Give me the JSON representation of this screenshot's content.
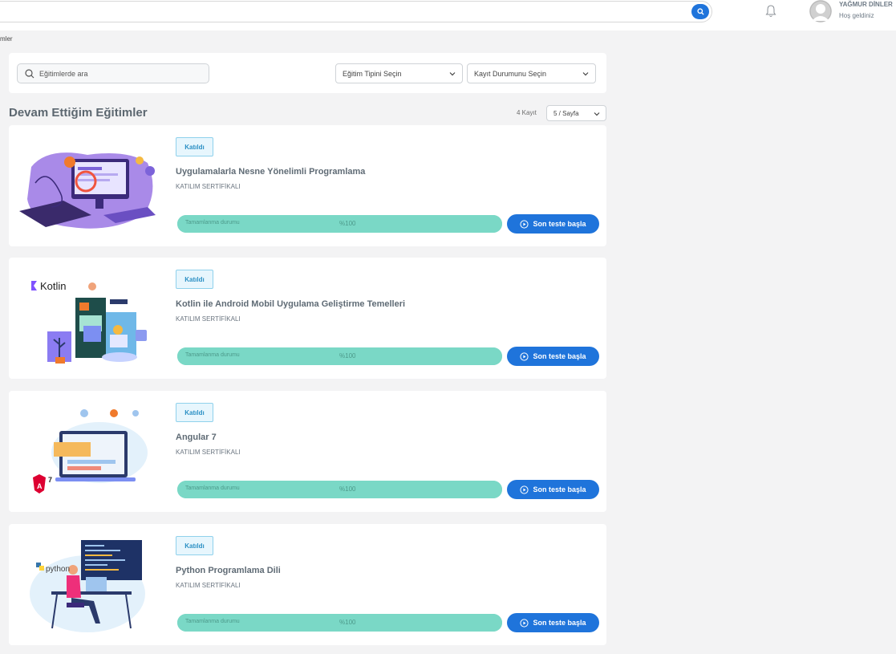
{
  "header": {
    "user_name": "YAĞMUR DİNLER",
    "greeting": "Hoş geldiniz",
    "icons": [
      "search-icon",
      "bell-icon",
      "user-avatar"
    ]
  },
  "breadcrumb": "mler",
  "filters": {
    "search_placeholder": "Eğitimlerde ara",
    "type_select": "Eğitim Tipini Seçin",
    "status_select": "Kayıt Durumunu Seçin"
  },
  "section": {
    "title": "Devam Ettiğim Eğitimler",
    "record_count": "4 Kayıt",
    "page_size": "5 / Sayfa"
  },
  "courses": [
    {
      "badge": "Katıldı",
      "title": "Uygulamalarla Nesne Yönelimli Programlama",
      "certificate": "KATILIM SERTİFİKALI",
      "progress_label": "Tamamlanma durumu",
      "progress_text": "%100",
      "progress": 100,
      "button": "Son teste başla"
    },
    {
      "badge": "Katıldı",
      "title": "Kotlin ile Android Mobil Uygulama Geliştirme Temelleri",
      "certificate": "KATILIM SERTİFİKALI",
      "progress_label": "Tamamlanma durumu",
      "progress_text": "%100",
      "progress": 100,
      "button": "Son teste başla",
      "thumb_text": "Kotlin"
    },
    {
      "badge": "Katıldı",
      "title": "Angular 7",
      "certificate": "KATILIM SERTİFİKALI",
      "progress_label": "Tamamlanma durumu",
      "progress_text": "%100",
      "progress": 100,
      "button": "Son teste başla",
      "thumb_text": "7"
    },
    {
      "badge": "Katıldı",
      "title": "Python Programlama Dili",
      "certificate": "KATILIM SERTİFİKALI",
      "progress_label": "Tamamlanma durumu",
      "progress_text": "%100",
      "progress": 100,
      "button": "Son teste başla",
      "thumb_text": "python"
    }
  ],
  "colors": {
    "primary": "#1f74db",
    "progress": "#7ad8c6",
    "badge_border": "#8fd1ec",
    "badge_bg": "#e7f6fd"
  }
}
